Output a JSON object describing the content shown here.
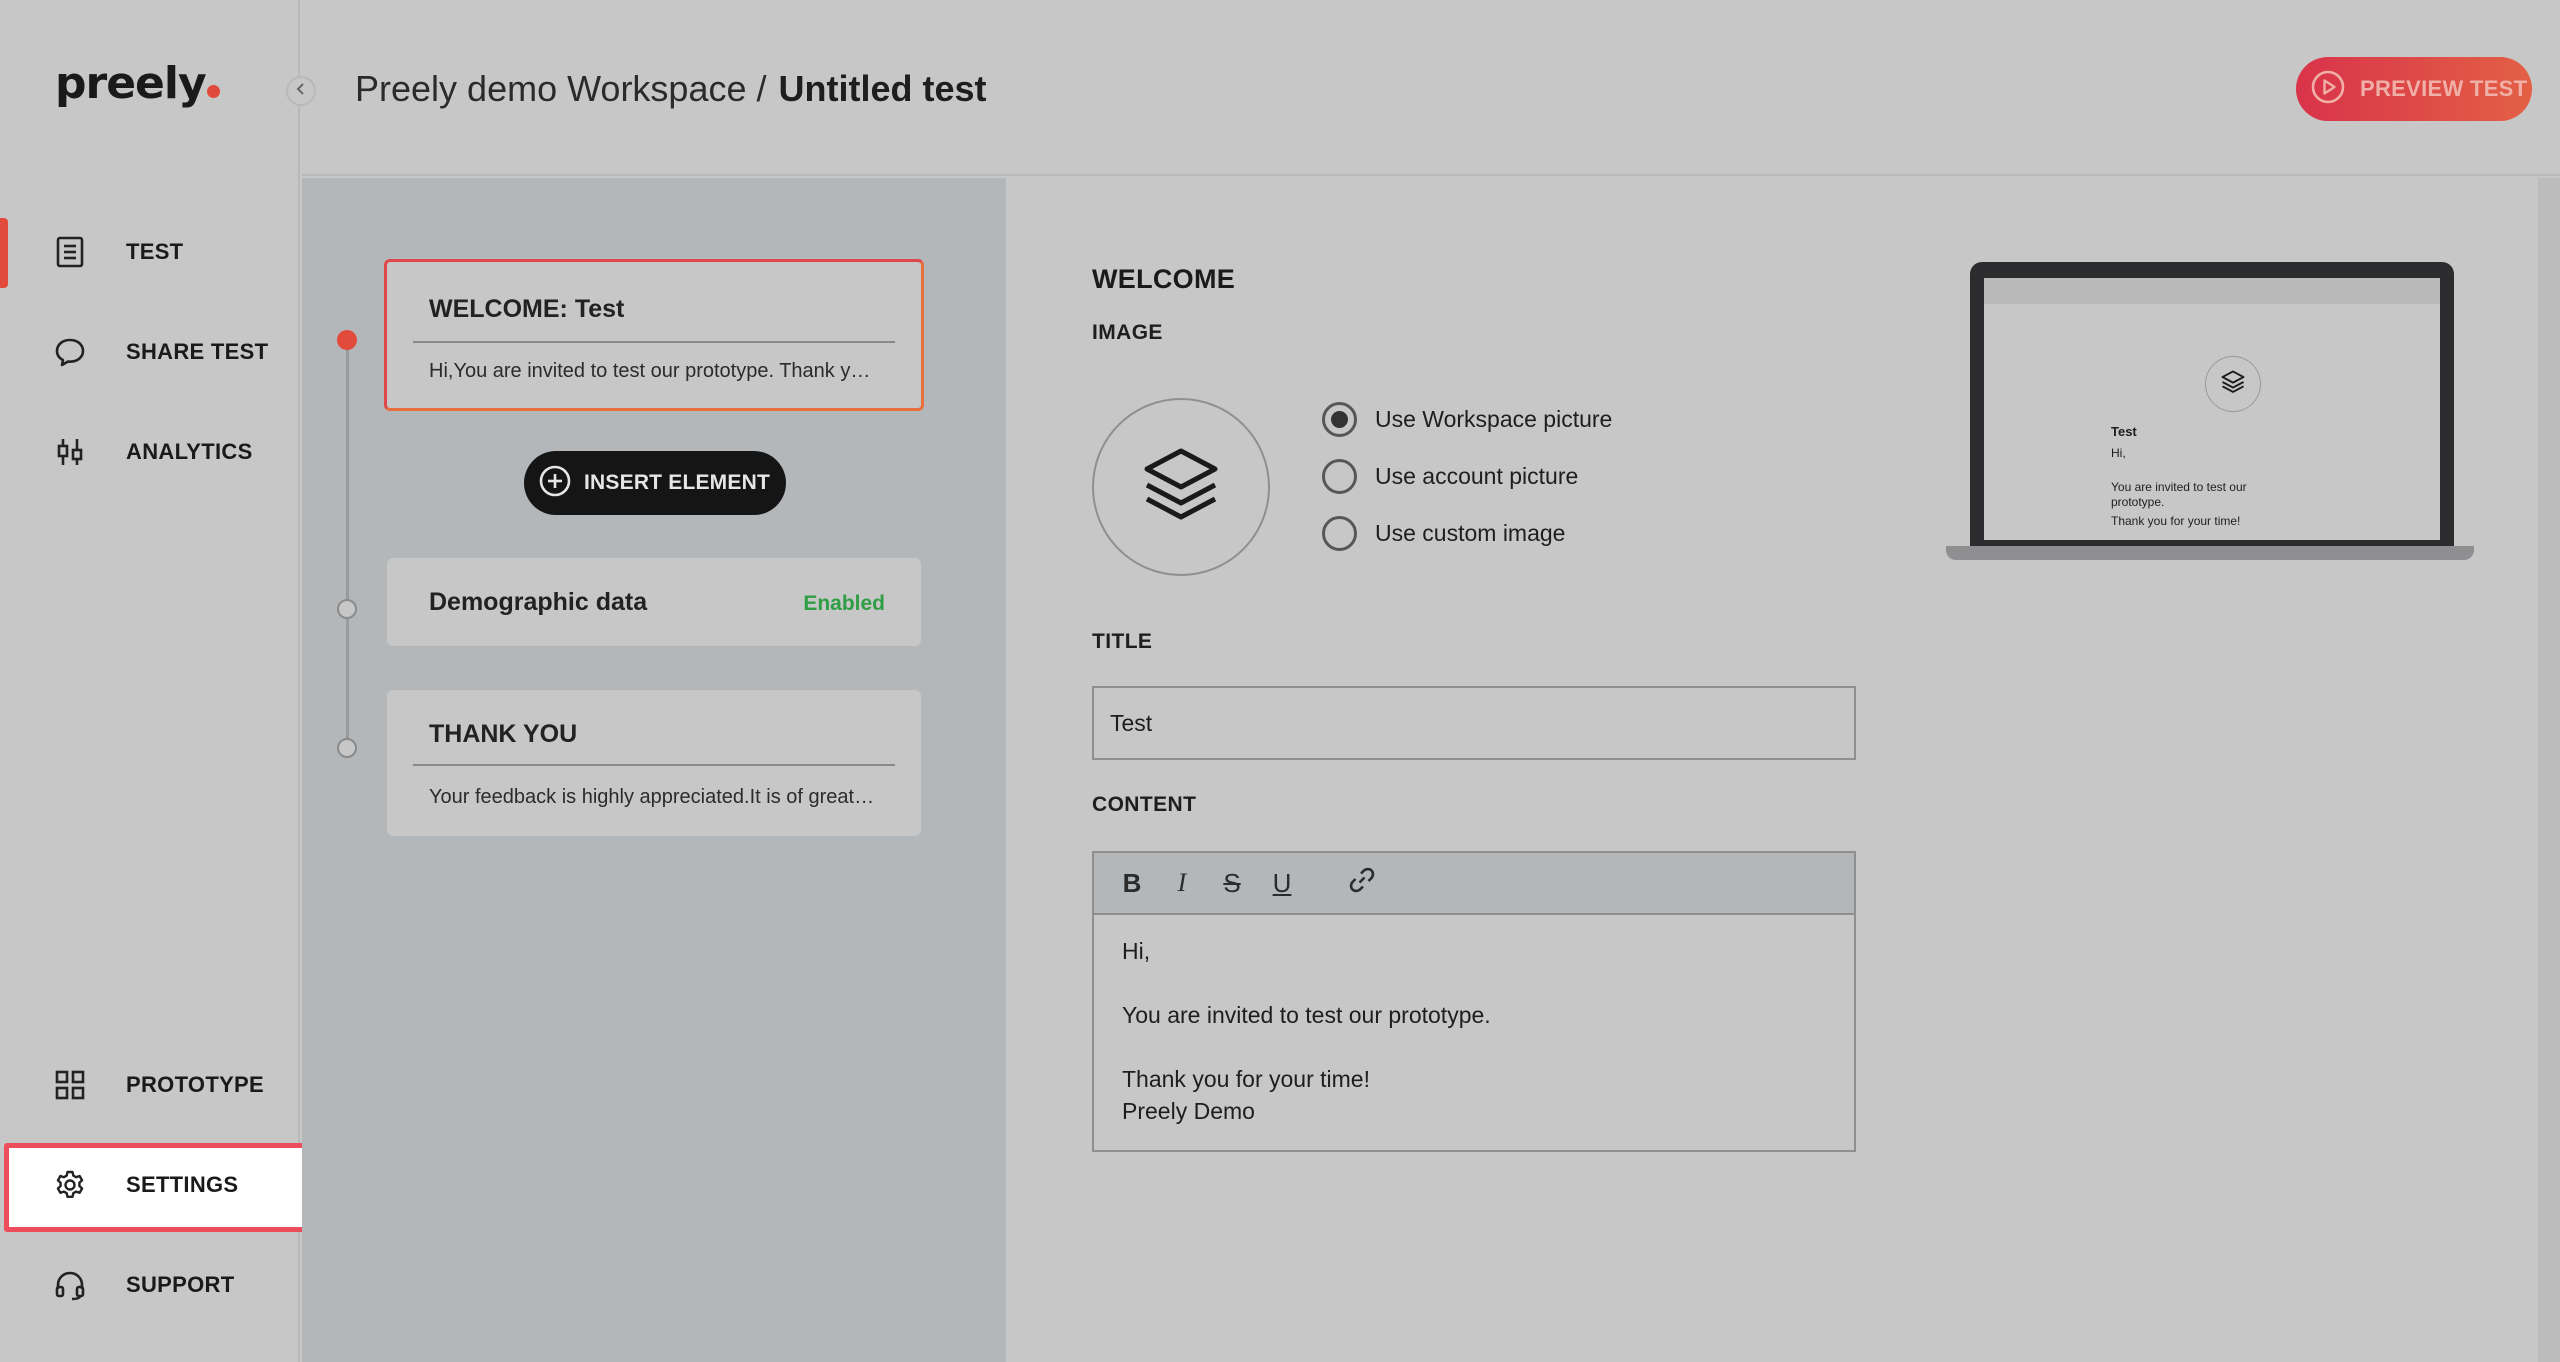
{
  "app": {
    "logo_text": "preely"
  },
  "sidebar": {
    "items": [
      {
        "label": "TEST",
        "icon": "document-icon"
      },
      {
        "label": "SHARE TEST",
        "icon": "speech-bubble-icon"
      },
      {
        "label": "ANALYTICS",
        "icon": "analytics-icon"
      },
      {
        "label": "PROTOTYPE",
        "icon": "grid-icon"
      },
      {
        "label": "SETTINGS",
        "icon": "gear-icon"
      },
      {
        "label": "SUPPORT",
        "icon": "headset-icon"
      }
    ]
  },
  "header": {
    "workspace": "Preely demo Workspace /",
    "test_name": "Untitled test",
    "preview_label": "PREVIEW TEST"
  },
  "elements": {
    "welcome": {
      "title": "WELCOME:  Test",
      "snippet": "Hi,You are invited to test our prototype. Thank you for your time!Preely Demo"
    },
    "insert_label": "INSERT ELEMENT",
    "demographic": {
      "title": "Demographic data",
      "status": "Enabled"
    },
    "thankyou": {
      "title": "THANK YOU",
      "snippet": "Your feedback is highly appreciated.It is of great value to us"
    }
  },
  "editor": {
    "heading": "WELCOME",
    "image_label": "IMAGE",
    "image_options": [
      {
        "label": "Use Workspace picture",
        "selected": true
      },
      {
        "label": "Use account picture",
        "selected": false
      },
      {
        "label": "Use custom image",
        "selected": false
      }
    ],
    "title_label": "TITLE",
    "title_value": "Test",
    "content_label": "CONTENT",
    "content_lines": [
      "Hi,",
      "",
      "You are invited to test our prototype.",
      "",
      "Thank you for your time!",
      "Preely Demo"
    ]
  },
  "preview": {
    "title": "Test",
    "greeting": "Hi,",
    "body": "You are invited to test our prototype.",
    "thanks": "Thank you for your time!"
  },
  "colors": {
    "accent": "#e24a3b",
    "enabled_green": "#2f9e44",
    "highlight_border": "#ee4d5c"
  }
}
